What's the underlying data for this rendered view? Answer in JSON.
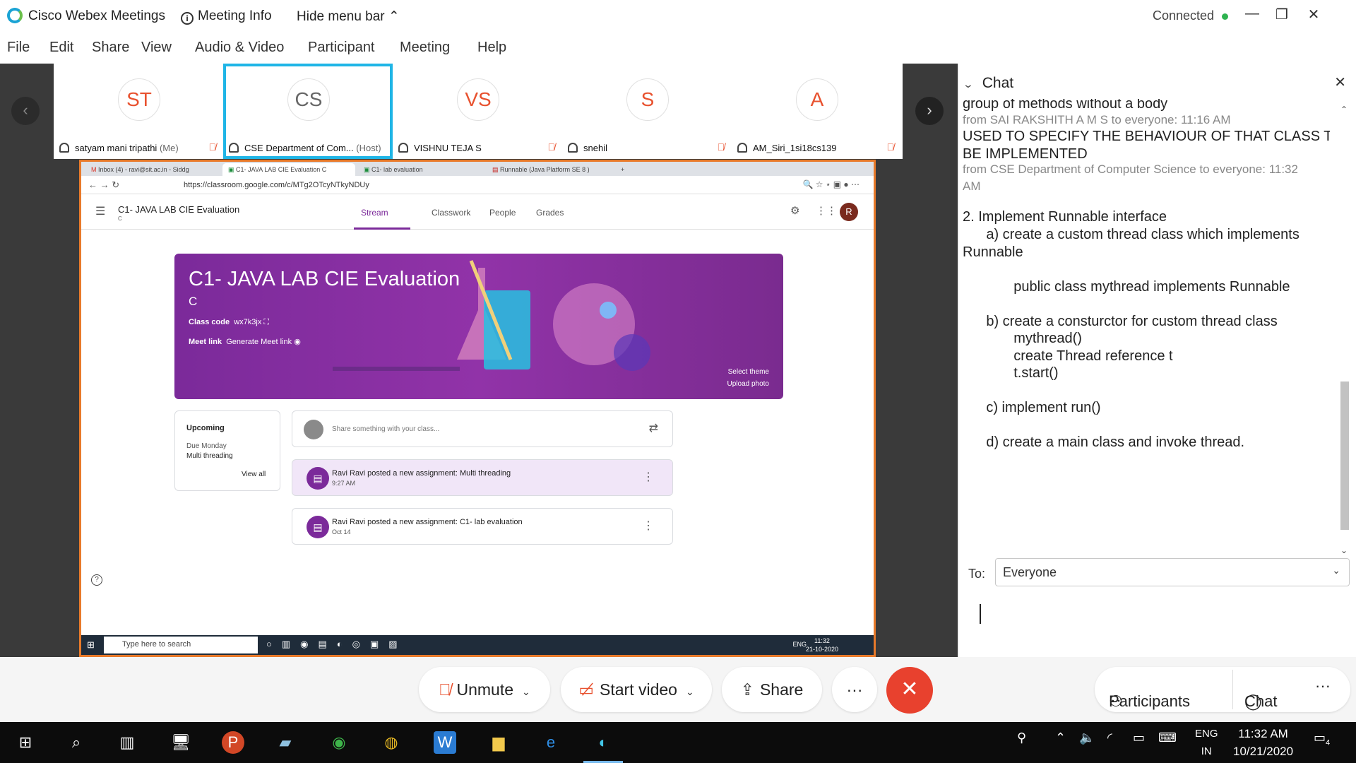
{
  "window": {
    "app_title": "Cisco Webex Meetings",
    "meeting_info": "Meeting Info",
    "hide_menu": "Hide menu bar",
    "status": "Connected",
    "status_color": "#2eb350"
  },
  "menu": [
    "File",
    "Edit",
    "Share",
    "View",
    "Audio & Video",
    "Participant",
    "Meeting",
    "Help"
  ],
  "participants": [
    {
      "initials": "ST",
      "name": "satyam mani tripathi",
      "tag": "(Me)"
    },
    {
      "initials": "CS",
      "name": "CSE Department of Com...",
      "tag": "(Host)"
    },
    {
      "initials": "VS",
      "name": "VISHNU TEJA S",
      "tag": ""
    },
    {
      "initials": "S",
      "name": "snehil",
      "tag": ""
    },
    {
      "initials": "A",
      "name": "AM_Siri_1si18cs139",
      "tag": ""
    }
  ],
  "shared": {
    "tabs": [
      "Inbox (4) - ravi@sit.ac.in - Siddg",
      "C1- JAVA LAB CIE Evaluation C",
      "C1- lab evaluation",
      "Runnable (Java Platform SE 8 )"
    ],
    "url": "https://classroom.google.com/c/MTg2OTcyNTkyNDUy",
    "class_name": "C1- JAVA LAB CIE Evaluation",
    "class_section": "C",
    "nav_tabs": [
      "Stream",
      "Classwork",
      "People",
      "Grades"
    ],
    "avatar_letter": "R",
    "banner_title": "C1- JAVA LAB CIE Evaluation",
    "banner_section": "C",
    "class_code_label": "Class code",
    "class_code": "wx7k3jx",
    "meet_label": "Meet link",
    "meet_action": "Generate Meet link",
    "select_theme": "Select theme",
    "upload_photo": "Upload photo",
    "upcoming_title": "Upcoming",
    "upcoming_due": "Due Monday",
    "upcoming_item": "Multi threading",
    "view_all": "View all",
    "share_placeholder": "Share something with your class...",
    "posts": [
      {
        "text": "Ravi Ravi posted a new assignment: Multi threading",
        "time": "9:27 AM"
      },
      {
        "text": "Ravi Ravi posted a new assignment: C1- lab evaluation",
        "time": "Oct 14"
      }
    ],
    "search_placeholder": "Type here to search",
    "tray_lang": "ENG",
    "tray_time": "11:32",
    "tray_date": "21-10-2020"
  },
  "chat": {
    "title": "Chat",
    "lines": [
      {
        "kind": "msg",
        "text": "group of methods without a body"
      },
      {
        "kind": "meta",
        "text": "from SAI RAKSHITH A M S to everyone:     11:16 AM"
      },
      {
        "kind": "msg",
        "text": "USED TO SPECIFY THE BEHAVIOUR OF THAT CLASS TO"
      },
      {
        "kind": "msg",
        "text": "BE IMPLEMENTED"
      },
      {
        "kind": "meta",
        "text": "from CSE Department of Computer Science to everyone:    11:32"
      },
      {
        "kind": "meta",
        "text": "AM"
      },
      {
        "kind": "msg",
        "text": "2. Implement Runnable interface"
      },
      {
        "kind": "msg",
        "text": "      a) create a custom thread class which implements"
      },
      {
        "kind": "msg",
        "text": "Runnable"
      },
      {
        "kind": "msg",
        "text": "             public class mythread implements Runnable"
      },
      {
        "kind": "msg",
        "text": "      b) create a consturctor for custom thread class"
      },
      {
        "kind": "msg",
        "text": "             mythread()"
      },
      {
        "kind": "msg",
        "text": "             create Thread reference t"
      },
      {
        "kind": "msg",
        "text": "             t.start()"
      },
      {
        "kind": "msg",
        "text": "      c) implement run()"
      },
      {
        "kind": "msg",
        "text": "      d) create a main class and invoke thread."
      }
    ],
    "to_label": "To:",
    "to_value": "Everyone"
  },
  "controls": {
    "unmute": "Unmute",
    "start_video": "Start video",
    "share": "Share",
    "more": "···",
    "participants": "Participants",
    "chat": "Chat"
  },
  "taskbar": {
    "lang_line1": "ENG",
    "lang_line2": "IN",
    "time": "11:32 AM",
    "date": "10/21/2020",
    "notif_count": "4"
  }
}
